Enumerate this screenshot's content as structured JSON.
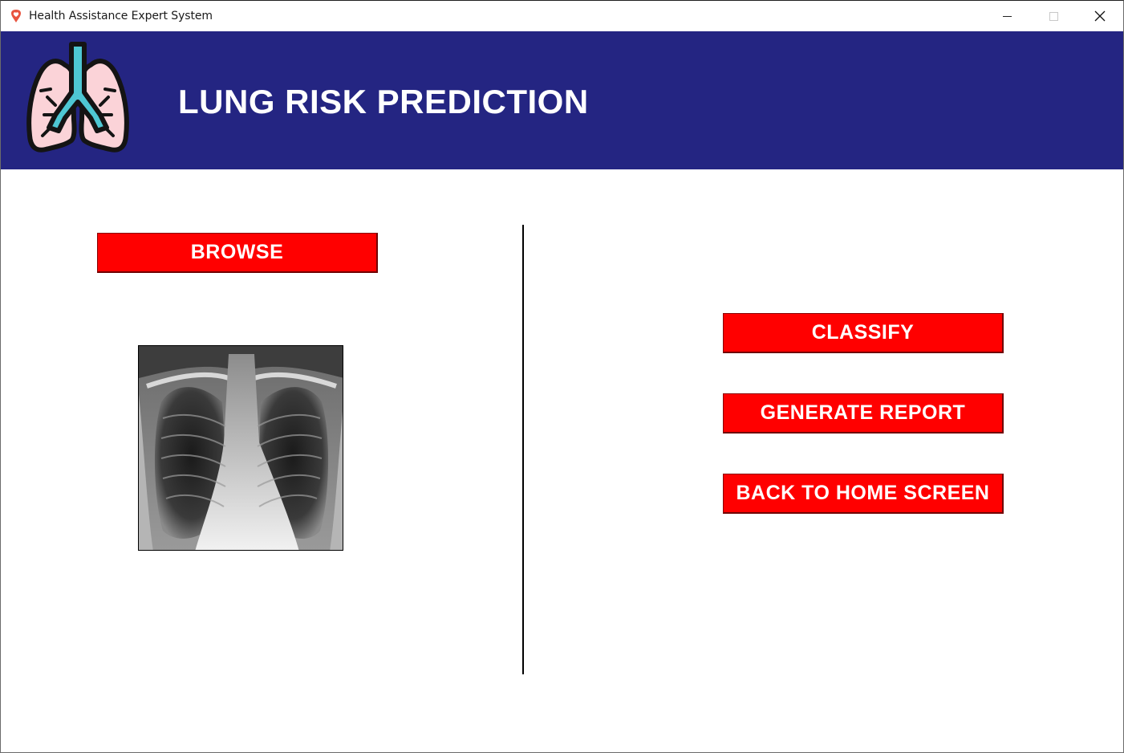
{
  "window": {
    "title": "Health Assistance Expert System",
    "app_icon": "heart-location-icon",
    "controls": [
      "minimize-icon",
      "maximize-icon",
      "close-icon"
    ]
  },
  "header": {
    "title": "LUNG RISK PREDICTION",
    "logo_icon": "lungs-icon",
    "background_color": "#242582"
  },
  "left_panel": {
    "browse_label": "BROWSE",
    "preview_image": "chest-xray-image"
  },
  "right_panel": {
    "classify_label": "CLASSIFY",
    "report_label": "GENERATE REPORT",
    "home_label": "BACK TO HOME SCREEN"
  },
  "colors": {
    "button": "#ff0000",
    "button_text": "#ffffff",
    "header_text": "#ffffff"
  }
}
